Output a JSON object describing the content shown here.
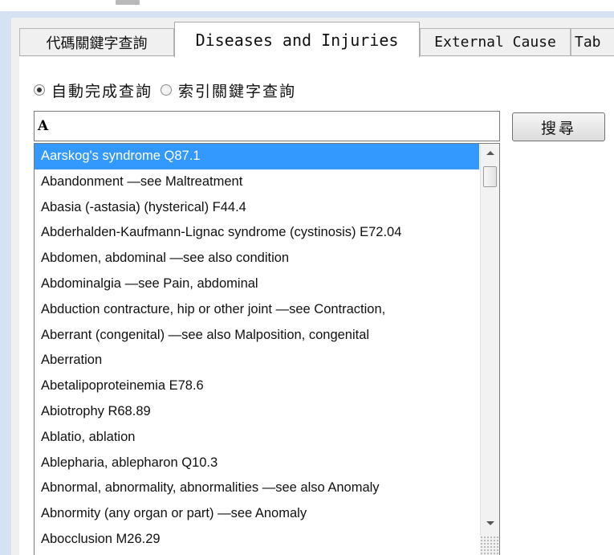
{
  "tabs": [
    {
      "label": "代碼關鍵字查詢"
    },
    {
      "label": "Diseases and Injuries"
    },
    {
      "label": "External Cause"
    },
    {
      "label": "Tab"
    }
  ],
  "search_mode": {
    "options": [
      {
        "label": "自動完成查詢",
        "checked": true
      },
      {
        "label": "索引關鍵字查詢",
        "checked": false
      }
    ]
  },
  "search": {
    "value": "A",
    "button_label": "搜尋"
  },
  "suggestions": [
    "Aarskog's syndrome Q87.1",
    "Abandonment —see Maltreatment",
    "Abasia (-astasia) (hysterical) F44.4",
    "Abderhalden-Kaufmann-Lignac syndrome (cystinosis) E72.04",
    "Abdomen, abdominal —see also condition",
    "Abdominalgia —see Pain, abdominal",
    "Abduction contracture, hip or other joint —see Contraction,",
    "Aberrant (congenital) —see also Malposition, congenital",
    "Aberration",
    "Abetalipoproteinemia E78.6",
    "Abiotrophy R68.89",
    "Ablatio, ablation",
    "Ablepharia, ablepharon Q10.3",
    "Abnormal, abnormality, abnormalities —see also Anomaly",
    "Abnormity (any organ or part) —see Anomaly",
    "Abocclusion M26.29"
  ],
  "selected_index": 0,
  "colors": {
    "selection": "#3399ff",
    "frame": "#d5e2f2"
  }
}
